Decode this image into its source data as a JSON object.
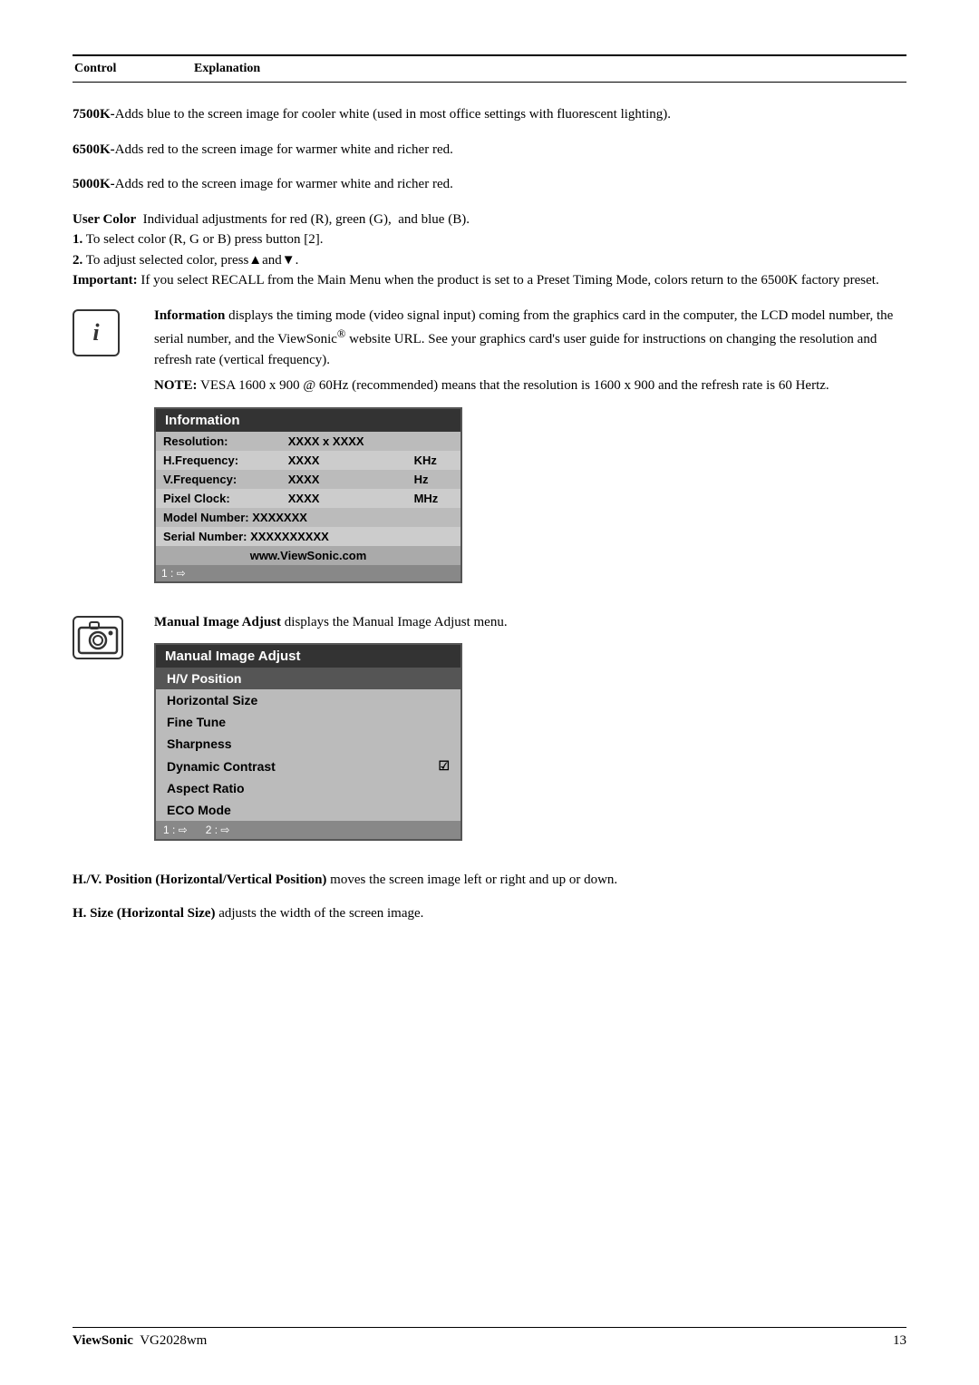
{
  "header": {
    "col1": "Control",
    "col2": "Explanation"
  },
  "sections": [
    {
      "id": "7500k",
      "icon": null,
      "paragraphs": [
        "<b>7500K-</b>Adds blue to the screen image for cooler white (used in most office settings with fluorescent lighting)."
      ]
    },
    {
      "id": "6500k",
      "icon": null,
      "paragraphs": [
        "<b>6500K-</b>Adds red to the screen image for warmer white and richer red."
      ]
    },
    {
      "id": "5000k",
      "icon": null,
      "paragraphs": [
        "<b>5000K-</b>Adds red to the screen image for warmer white and richer red."
      ]
    },
    {
      "id": "user-color",
      "icon": null,
      "paragraphs": [
        "<b>User Color</b>  Individual adjustments for red (R), green (G),  and blue (B).",
        "<b>1.</b> To select color (R, G or B) press button [2].",
        "<b>2.</b> To adjust selected color, press▲and▼.",
        "<b>Important:</b> If you select RECALL from the Main Menu when the product is set to a Preset Timing Mode, colors return to the 6500K factory preset."
      ]
    }
  ],
  "information_section": {
    "icon_label": "i",
    "intro": "<b>Information</b> displays the timing mode (video signal input) coming from the graphics card in the computer, the LCD model number, the serial number, and the ViewSonic® website URL. See your graphics card's user guide for instructions on changing the resolution and refresh rate (vertical frequency).",
    "note": "<b>NOTE:</b> VESA 1600 x 900 @ 60Hz (recommended) means that the resolution is 1600 x 900 and the refresh rate is 60 Hertz.",
    "box": {
      "title": "Information",
      "rows": [
        {
          "label": "Resolution:",
          "value": "XXXX x XXXX",
          "unit": ""
        },
        {
          "label": "H.Frequency:",
          "value": "XXXX",
          "unit": "KHz"
        },
        {
          "label": "V.Frequency:",
          "value": "XXXX",
          "unit": "Hz"
        },
        {
          "label": "Pixel Clock:",
          "value": "XXXX",
          "unit": "MHz"
        },
        {
          "label": "Model Number:",
          "value": "XXXXXXX",
          "unit": ""
        },
        {
          "label": "Serial Number:",
          "value": "XXXXXXXXXX",
          "unit": ""
        }
      ],
      "website": "www.ViewSonic.com",
      "footer": "1 : ➨"
    }
  },
  "manual_image_adjust_section": {
    "icon_label": "📷",
    "intro": "<b>Manual Image Adjust</b> displays the Manual Image Adjust menu.",
    "box": {
      "title": "Manual Image Adjust",
      "items": [
        {
          "label": "H/V Position",
          "selected": true,
          "check": false
        },
        {
          "label": "Horizontal Size",
          "selected": false,
          "check": false
        },
        {
          "label": "Fine Tune",
          "selected": false,
          "check": false
        },
        {
          "label": "Sharpness",
          "selected": false,
          "check": false
        },
        {
          "label": "Dynamic Contrast",
          "selected": false,
          "check": true
        },
        {
          "label": "Aspect Ratio",
          "selected": false,
          "check": false
        },
        {
          "label": "ECO Mode",
          "selected": false,
          "check": false
        }
      ],
      "footer": "1 : ➨    2 : ➨"
    }
  },
  "bottom_paragraphs": [
    "<b>H./V. Position (Horizontal/Vertical Position)</b> moves the screen image left or right and up or down.",
    "<b>H. Size (Horizontal Size)</b> adjusts the width of the screen image."
  ],
  "footer": {
    "brand": "ViewSonic",
    "model": "VG2028wm",
    "page": "13"
  }
}
